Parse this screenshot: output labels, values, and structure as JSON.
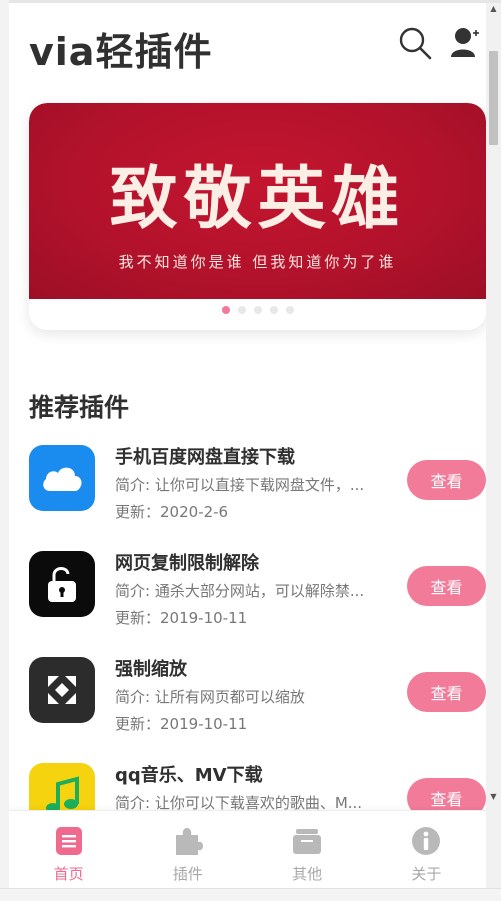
{
  "header": {
    "title": "via轻插件",
    "search_icon": "search-icon",
    "user_icon": "user-add-icon"
  },
  "banner": {
    "headline": "致敬英雄",
    "subline": "我不知道你是谁   但我知道你为了谁",
    "slide_count": 5,
    "active_slide": 1,
    "colors": {
      "background": "#b3122c",
      "text": "#fbeee4",
      "active_dot": "#f07a98"
    }
  },
  "section": {
    "title": "推荐插件"
  },
  "plugins": [
    {
      "name": "手机百度网盘直接下载",
      "desc": "简介: 让你可以直接下载网盘文件，...",
      "date": "更新：2020-2-6",
      "button": "查看",
      "icon": "cloud-icon",
      "icon_bg": "#1a8cf0"
    },
    {
      "name": "网页复制限制解除",
      "desc": "简介: 通杀大部分网站，可以解除禁...",
      "date": "更新：2019-10-11",
      "button": "查看",
      "icon": "unlock-icon",
      "icon_bg": "#0b0b0b"
    },
    {
      "name": "强制缩放",
      "desc": "简介: 让所有网页都可以缩放",
      "date": "更新：2019-10-11",
      "button": "查看",
      "icon": "zoom-arrows-icon",
      "icon_bg": "#2c2c2c"
    },
    {
      "name": "qq音乐、MV下载",
      "desc": "简介: 让你可以下载喜欢的歌曲、M...",
      "date": "",
      "button": "查看",
      "icon": "music-note-icon",
      "icon_bg": "#f5d30e"
    }
  ],
  "tabbar": {
    "items": [
      {
        "label": "首页",
        "icon": "home-doc-icon",
        "active": true
      },
      {
        "label": "插件",
        "icon": "puzzle-icon",
        "active": false
      },
      {
        "label": "其他",
        "icon": "folder-icon",
        "active": false
      },
      {
        "label": "关于",
        "icon": "info-icon",
        "active": false
      }
    ],
    "colors": {
      "active": "#f06a8e",
      "inactive": "#a8a8a8"
    }
  },
  "theme": {
    "accent": "#f27b9a"
  }
}
